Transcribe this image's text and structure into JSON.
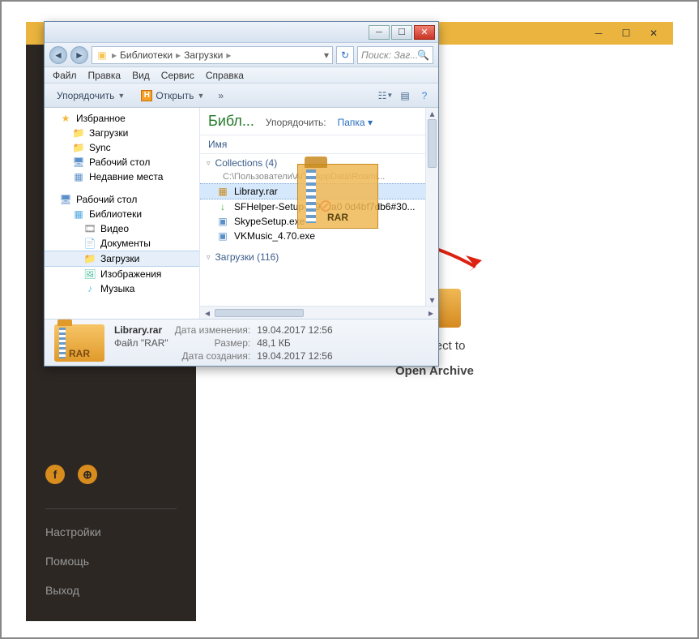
{
  "bg": {
    "drop1": "or Select to",
    "drop2": "Open Archive",
    "menu": [
      "Настройки",
      "Помощь",
      "Выход"
    ]
  },
  "explorer": {
    "breadcrumb": [
      "Библиотеки",
      "Загрузки"
    ],
    "search_placeholder": "Поиск: Заг...",
    "menubar": [
      "Файл",
      "Правка",
      "Вид",
      "Сервис",
      "Справка"
    ],
    "toolbar": {
      "organize": "Упорядочить",
      "open": "Открыть",
      "open_badge": "H"
    },
    "tree": {
      "favorites": "Избранное",
      "fav_items": [
        "Загрузки",
        "Sync",
        "Рабочий стол",
        "Недавние места"
      ],
      "desktop": "Рабочий стол",
      "libs": "Библиотеки",
      "lib_items": [
        "Видео",
        "Документы",
        "Загрузки",
        "Изображения",
        "Музыка"
      ]
    },
    "content": {
      "lib_label": "Библ...",
      "organize_label": "Упорядочить:",
      "folder_label": "Папка",
      "col_name": "Имя",
      "group1": "Collections (4)",
      "group1_sub": "C:\\Пользователи\\АПК\\AppData\\Roami...",
      "files": [
        {
          "name": "Library.rar",
          "kind": "rar"
        },
        {
          "name": "SFHelper-Setup-[199ea0  0d4bf7db6#30...",
          "kind": "dl"
        },
        {
          "name": "SkypeSetup.exe",
          "kind": "exe"
        },
        {
          "name": "VKMusic_4.70.exe",
          "kind": "exe"
        }
      ],
      "group2": "Загрузки (116)"
    },
    "details": {
      "filename": "Library.rar",
      "type": "Файл \"RAR\"",
      "mod_label": "Дата изменения:",
      "mod_val": "19.04.2017 12:56",
      "size_label": "Размер:",
      "size_val": "48,1 КБ",
      "created_label": "Дата создания:",
      "created_val": "19.04.2017 12:56",
      "icon_label": "RAR"
    }
  },
  "drag": {
    "label": "RAR"
  }
}
